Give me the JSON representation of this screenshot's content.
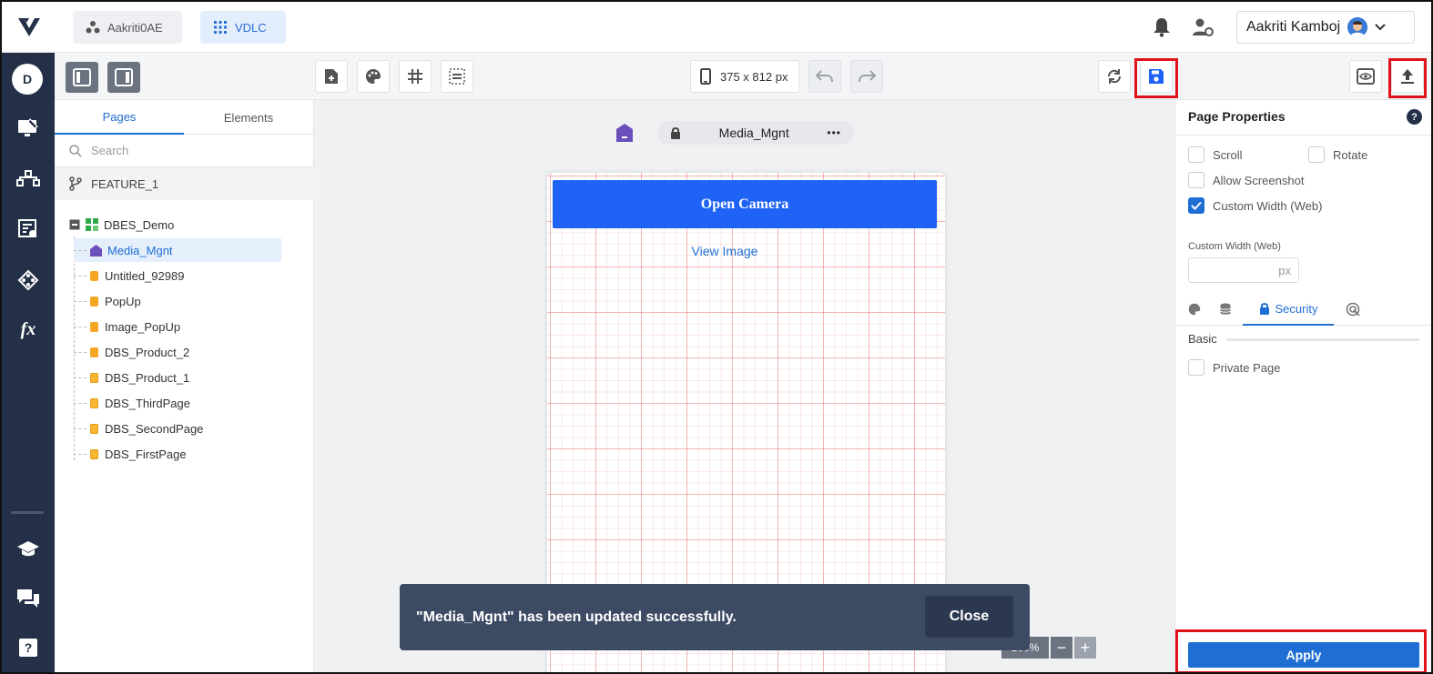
{
  "header": {
    "org_chip": "Aakriti0AE",
    "app_chip": "VDLC",
    "user_name": "Aakriti Kamboj"
  },
  "rail": {
    "avatar_letter": "D",
    "items": [
      "design-icon",
      "integration-icon",
      "config-icon",
      "workflow-icon",
      "function-icon"
    ],
    "bottom_items": [
      "learn-icon",
      "chat-icon",
      "help-icon"
    ]
  },
  "toolbar": {
    "device_size": "375 x 812 px"
  },
  "left_panel": {
    "tabs": [
      "Pages",
      "Elements"
    ],
    "active_tab": "Pages",
    "search_placeholder": "Search",
    "feature": "FEATURE_1",
    "root": "DBES_Demo",
    "pages": [
      {
        "label": "Media_Mgnt",
        "kind": "home",
        "selected": true
      },
      {
        "label": "Untitled_92989",
        "kind": "popup"
      },
      {
        "label": "PopUp",
        "kind": "popup"
      },
      {
        "label": "Image_PopUp",
        "kind": "popup"
      },
      {
        "label": "DBS_Product_2",
        "kind": "popup"
      },
      {
        "label": "DBS_Product_1",
        "kind": "page"
      },
      {
        "label": "DBS_ThirdPage",
        "kind": "page"
      },
      {
        "label": "DBS_SecondPage",
        "kind": "page"
      },
      {
        "label": "DBS_FirstPage",
        "kind": "page"
      }
    ]
  },
  "canvas": {
    "page_name": "Media_Mgnt",
    "more": "•••",
    "open_camera_label": "Open Camera",
    "view_image_label": "View Image",
    "zoom": "100%"
  },
  "toast": {
    "message": "\"Media_Mgnt\" has been updated successfully.",
    "close_label": "Close"
  },
  "right_panel": {
    "title": "Page Properties",
    "help": "?",
    "scroll_label": "Scroll",
    "rotate_label": "Rotate",
    "allow_screenshot_label": "Allow Screenshot",
    "custom_width_label": "Custom Width (Web)",
    "custom_width_field_label": "Custom Width (Web)",
    "custom_width_unit": "px",
    "active_tab": "Security",
    "basic_label": "Basic",
    "private_page_label": "Private Page",
    "apply_label": "Apply"
  },
  "colors": {
    "accent": "#1f6ed4",
    "rail": "#233047",
    "highlight": "#e0131b",
    "button_blue": "#1e63f5"
  }
}
